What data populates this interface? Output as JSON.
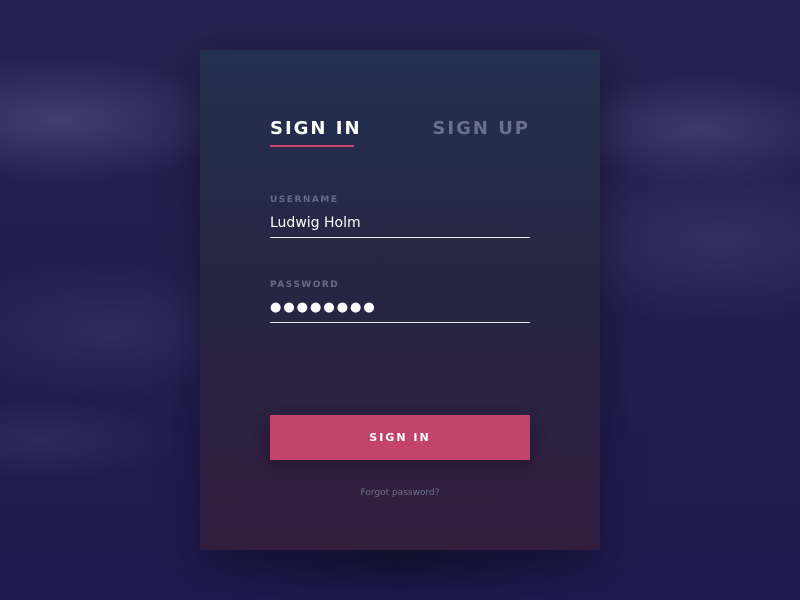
{
  "tabs": {
    "sign_in": "SIGN IN",
    "sign_up": "SIGN UP",
    "active": "sign_in"
  },
  "form": {
    "username": {
      "label": "USERNAME",
      "value": "Ludwig Holm"
    },
    "password": {
      "label": "PASSWORD",
      "value": "●●●●●●●●"
    },
    "submit_label": "SIGN IN",
    "forgot_label": "Forgot password?"
  },
  "colors": {
    "accent": "#c2436c",
    "card_top": "#23304f",
    "card_bottom": "#331d3f",
    "background": "#1f1b4a",
    "inactive_tab": "#6b6f8a"
  }
}
